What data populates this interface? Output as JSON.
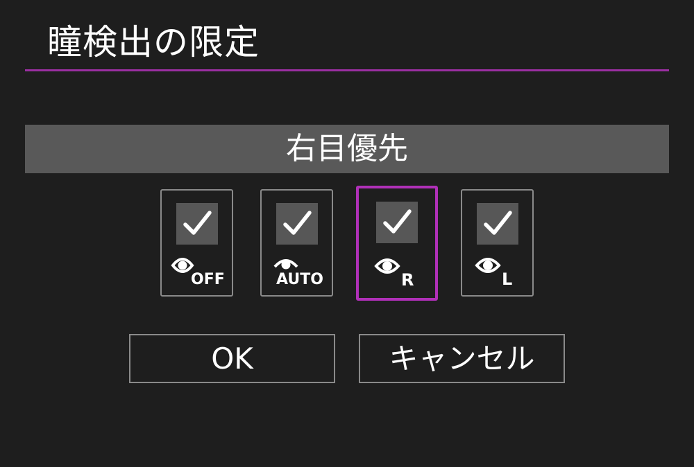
{
  "screen": {
    "title": "瞳検出の限定"
  },
  "selection": {
    "current_label": "右目優先"
  },
  "options": [
    {
      "icon": "eye-off-icon",
      "icon_text": "OFF",
      "checked": true,
      "selected": false
    },
    {
      "icon": "eye-auto-icon",
      "icon_text": "AUTO",
      "checked": true,
      "selected": false
    },
    {
      "icon": "eye-right-icon",
      "icon_text": "R",
      "checked": true,
      "selected": true
    },
    {
      "icon": "eye-left-icon",
      "icon_text": "L",
      "checked": true,
      "selected": false
    }
  ],
  "buttons": {
    "ok_label": "OK",
    "cancel_label": "キャンセル"
  },
  "colors": {
    "background": "#1e1e1e",
    "accent": "#b030b8",
    "title_rule": "#9b2fa2",
    "selection_bar": "#595959",
    "check_box": "#575757",
    "border": "#8a8a8a"
  }
}
